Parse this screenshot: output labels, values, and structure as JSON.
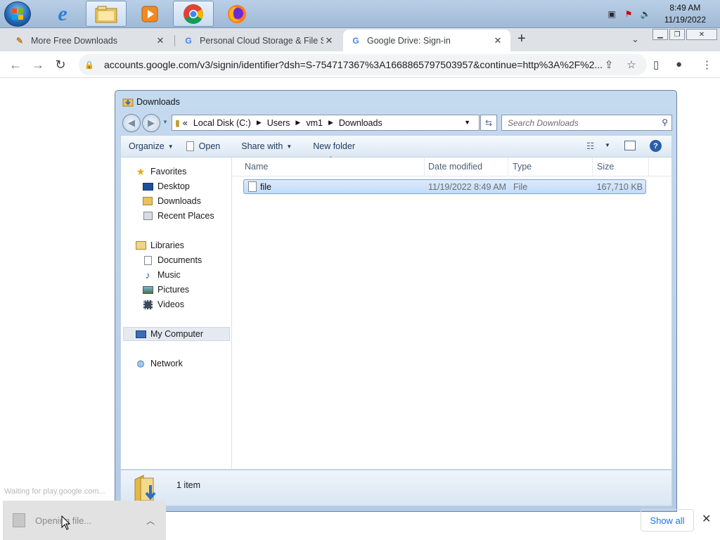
{
  "taskbar": {
    "clock_time": "8:49 AM",
    "clock_date": "11/19/2022"
  },
  "browser": {
    "tabs": [
      {
        "label": "More Free Downloads",
        "icon": "pen-icon"
      },
      {
        "label": "Personal Cloud Storage & File Sh",
        "icon": "google-icon"
      },
      {
        "label": "Google Drive: Sign-in",
        "icon": "google-icon",
        "active": true
      }
    ],
    "new_tab_label": "+",
    "url": "accounts.google.com/v3/signin/identifier?dsh=S-754717367%3A1668865797503957&continue=http%3A%2F%2..."
  },
  "explorer": {
    "title": "Downloads",
    "breadcrumb": [
      "Local Disk (C:)",
      "Users",
      "vm1",
      "Downloads"
    ],
    "search_placeholder": "Search Downloads",
    "commands": {
      "organize": "Organize",
      "open": "Open",
      "share_with": "Share with",
      "new_folder": "New folder"
    },
    "nav": {
      "favorites": "Favorites",
      "desktop": "Desktop",
      "downloads": "Downloads",
      "recent_places": "Recent Places",
      "libraries": "Libraries",
      "documents": "Documents",
      "music": "Music",
      "pictures": "Pictures",
      "videos": "Videos",
      "my_computer": "My Computer",
      "network": "Network"
    },
    "columns": {
      "name": "Name",
      "date_modified": "Date modified",
      "type": "Type",
      "size": "Size"
    },
    "files": [
      {
        "name": "file",
        "date_modified": "11/19/2022 8:49 AM",
        "type": "File",
        "size": "167,710 KB"
      }
    ],
    "status": "1 item"
  },
  "download_bar": {
    "status_text": "Waiting for play.google.com...",
    "item_label": "Opening file...",
    "show_all": "Show all"
  },
  "colors": {
    "accent": "#1a73e8",
    "selection": "#c1dcfc"
  }
}
